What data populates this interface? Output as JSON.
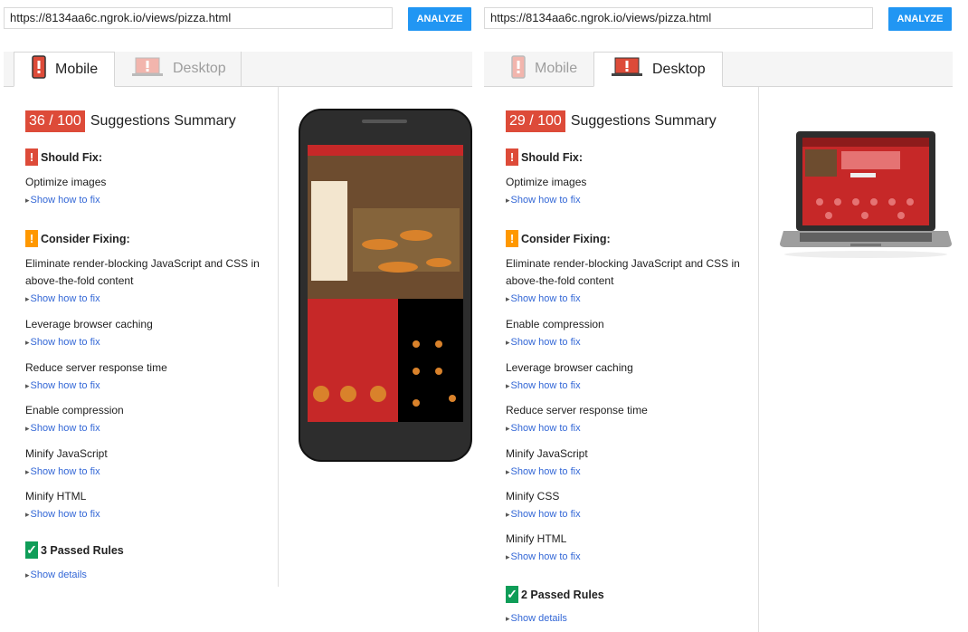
{
  "left": {
    "url": "https://8134aa6c.ngrok.io/views/pizza.html",
    "analyze": "ANALYZE",
    "tabs": [
      {
        "label": "Mobile",
        "active": true
      },
      {
        "label": "Desktop",
        "active": false
      }
    ],
    "score": "36 / 100",
    "summary": "Suggestions Summary",
    "should_fix_title": "Should Fix:",
    "should_fix": [
      "Optimize images"
    ],
    "consider_title": "Consider Fixing:",
    "consider": [
      "Eliminate render-blocking JavaScript and CSS in above-the-fold content",
      "Leverage browser caching",
      "Reduce server response time",
      "Enable compression",
      "Minify JavaScript",
      "Minify HTML"
    ],
    "passed": "3 Passed Rules",
    "show_fix": "Show how to fix",
    "show_details": "Show details"
  },
  "right": {
    "url": "https://8134aa6c.ngrok.io/views/pizza.html",
    "analyze": "ANALYZE",
    "tabs": [
      {
        "label": "Mobile",
        "active": false
      },
      {
        "label": "Desktop",
        "active": true
      }
    ],
    "score": "29 / 100",
    "summary": "Suggestions Summary",
    "should_fix_title": "Should Fix:",
    "should_fix": [
      "Optimize images"
    ],
    "consider_title": "Consider Fixing:",
    "consider": [
      "Eliminate render-blocking JavaScript and CSS in above-the-fold content",
      "Enable compression",
      "Leverage browser caching",
      "Reduce server response time",
      "Minify JavaScript",
      "Minify CSS",
      "Minify HTML"
    ],
    "passed": "2 Passed Rules",
    "show_fix": "Show how to fix",
    "show_details": "Show details"
  },
  "icons": {
    "error": "!",
    "warning": "!",
    "pass": "✓",
    "mobile": "mobile-icon",
    "desktop": "desktop-icon"
  },
  "colors": {
    "score_bg": "#dd4b39",
    "warning": "#ff9800",
    "pass": "#0f9d58",
    "analyze": "#2196f3",
    "link": "#3367d6"
  }
}
